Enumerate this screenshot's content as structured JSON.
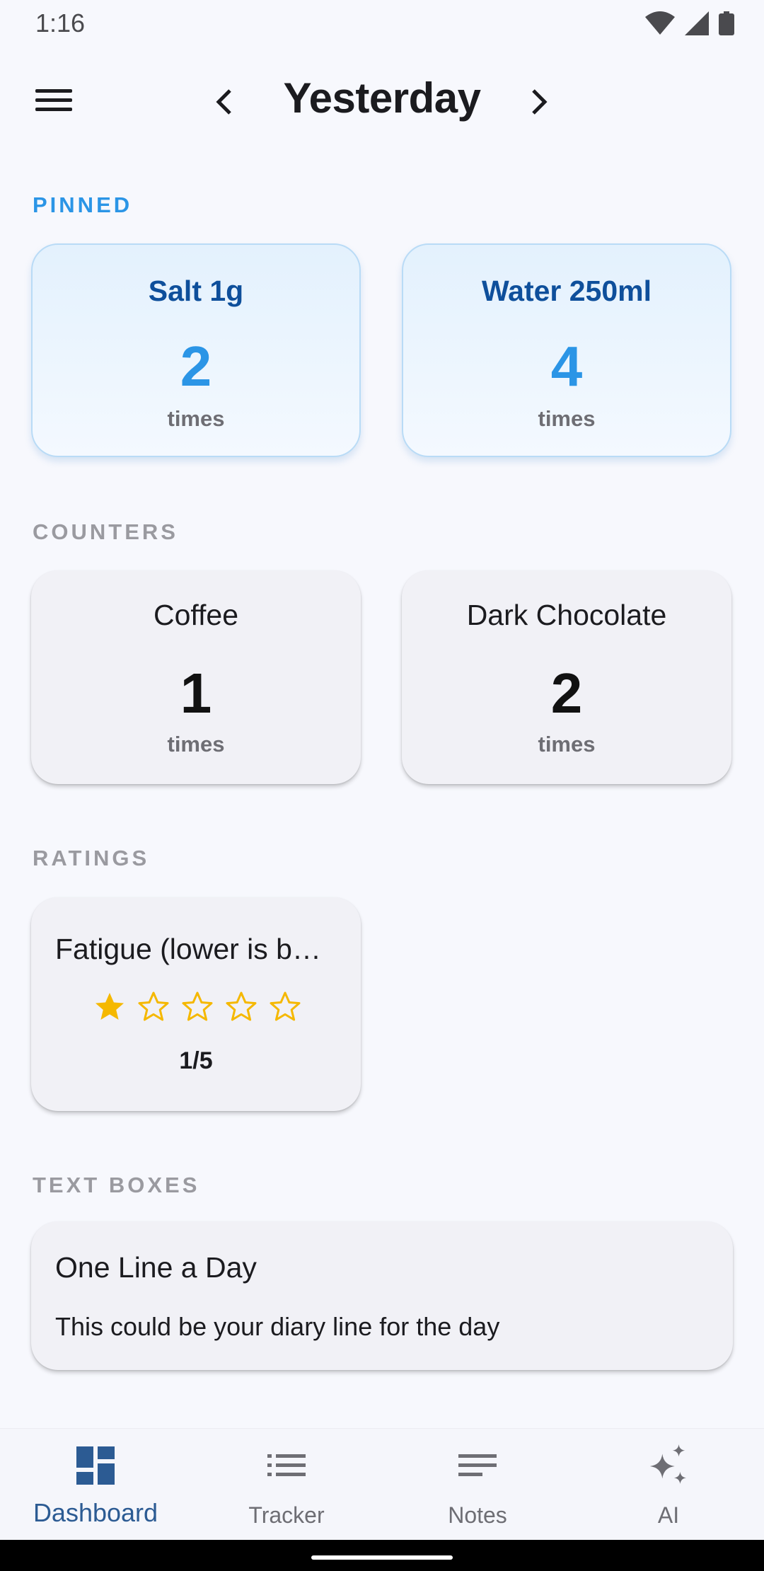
{
  "status_bar": {
    "time": "1:16"
  },
  "header": {
    "title": "Yesterday"
  },
  "sections": {
    "pinned": "PINNED",
    "counters": "COUNTERS",
    "ratings": "RATINGS",
    "text_boxes": "TEXT BOXES"
  },
  "pinned": [
    {
      "title": "Salt 1g",
      "count": "2",
      "unit": "times"
    },
    {
      "title": "Water 250ml",
      "count": "4",
      "unit": "times"
    }
  ],
  "counters": [
    {
      "title": "Coffee",
      "count": "1",
      "unit": "times"
    },
    {
      "title": "Dark Chocolate",
      "count": "2",
      "unit": "times"
    }
  ],
  "ratings": [
    {
      "title": "Fatigue (lower is b…",
      "rating": 1,
      "max": 5,
      "value_text": "1/5"
    }
  ],
  "text_boxes": [
    {
      "title": "One Line a Day",
      "body": "This could be your diary line for the day"
    }
  ],
  "bottom_nav": [
    {
      "label": "Dashboard",
      "icon": "dashboard-icon",
      "active": true
    },
    {
      "label": "Tracker",
      "icon": "list-icon",
      "active": false
    },
    {
      "label": "Notes",
      "icon": "notes-icon",
      "active": false
    },
    {
      "label": "AI",
      "icon": "sparkles-icon",
      "active": false
    }
  ],
  "colors": {
    "accent": "#2b95e6",
    "pinned_title": "#0e4f9b",
    "star": "#f5b800",
    "nav_active": "#2c5b93",
    "background": "#f7f8fd"
  }
}
